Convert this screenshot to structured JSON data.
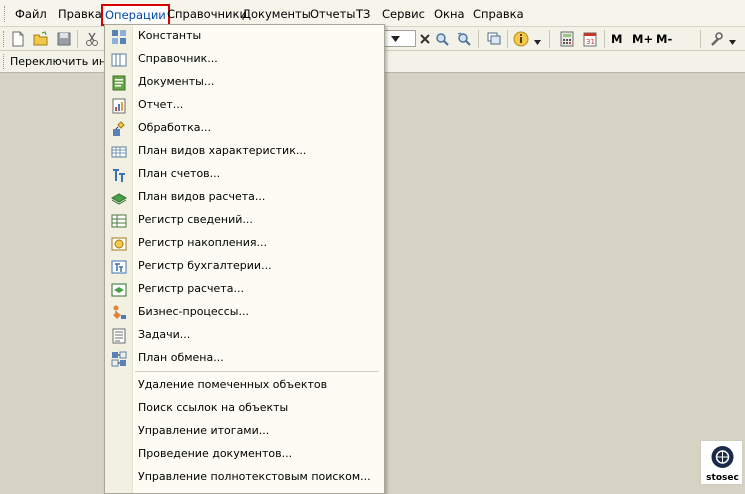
{
  "menubar": {
    "items": [
      "Файл",
      "Правка",
      "Операции",
      "Справочники",
      "Документы",
      "Отчеты",
      "ТЗ",
      "Сервис",
      "Окна",
      "Справка"
    ],
    "active_index": 2,
    "active_highlight_color": "#d90000"
  },
  "toolbar": {
    "icons": [
      "new-document-icon",
      "open-folder-icon",
      "save-icon",
      "cut-icon",
      "dropdown-close-icon",
      "search-icon",
      "search-refresh-icon",
      "windows-icon",
      "info-icon",
      "calculator-icon",
      "calendar-icon",
      "memory-icon",
      "tools-icon"
    ],
    "memory_buttons": [
      "M",
      "M+",
      "M-"
    ]
  },
  "toolbar2": {
    "switch_label": "Переключить инте"
  },
  "dropdown": {
    "items": [
      {
        "label": "Константы",
        "icon": "constants-icon"
      },
      {
        "label": "Справочник...",
        "icon": "catalog-icon"
      },
      {
        "label": "Документы...",
        "icon": "documents-icon"
      },
      {
        "label": "Отчет...",
        "icon": "report-icon"
      },
      {
        "label": "Обработка...",
        "icon": "processing-icon"
      },
      {
        "label": "План видов характеристик...",
        "icon": "characteristics-plan-icon"
      },
      {
        "label": "План счетов...",
        "icon": "chart-of-accounts-icon"
      },
      {
        "label": "План видов расчета...",
        "icon": "calculation-types-icon"
      },
      {
        "label": "Регистр сведений...",
        "icon": "info-register-icon"
      },
      {
        "label": "Регистр накопления...",
        "icon": "accumulation-register-icon"
      },
      {
        "label": "Регистр бухгалтерии...",
        "icon": "accounting-register-icon"
      },
      {
        "label": "Регистр расчета...",
        "icon": "calculation-register-icon"
      },
      {
        "label": "Бизнес-процессы...",
        "icon": "business-processes-icon"
      },
      {
        "label": "Задачи...",
        "icon": "tasks-icon"
      },
      {
        "label": "План обмена...",
        "icon": "exchange-plan-icon"
      }
    ],
    "service_items": [
      "Удаление помеченных объектов",
      "Поиск ссылок на объекты",
      "Управление итогами...",
      "Проведение документов...",
      "Управление полнотекстовым поиском..."
    ]
  },
  "watermark": {
    "text": "stosec"
  }
}
